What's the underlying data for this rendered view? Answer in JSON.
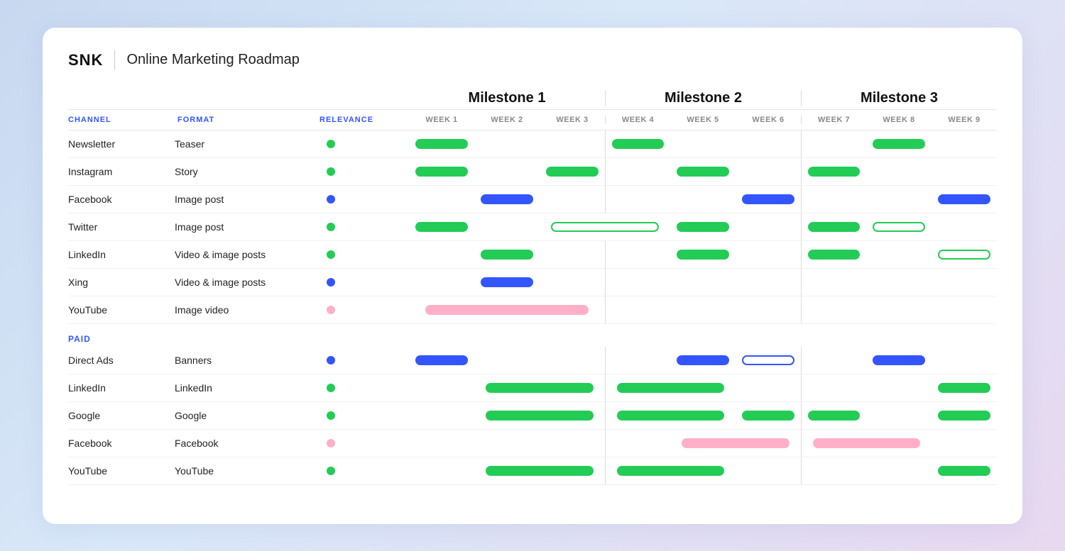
{
  "header": {
    "logo": "SNK",
    "title": "Online Marketing Roadmap"
  },
  "milestones": [
    {
      "label": "Milestone 1",
      "weeks": [
        "WEEK 1",
        "WEEK 2",
        "WEEK 3"
      ]
    },
    {
      "label": "Milestone 2",
      "weeks": [
        "WEEK 4",
        "WEEK 5",
        "WEEK 6"
      ]
    },
    {
      "label": "Milestone 3",
      "weeks": [
        "WEEK 7",
        "WEEK 8",
        "WEEK 9"
      ]
    }
  ],
  "columns": {
    "channel": "CHANNEL",
    "format": "FORMAT",
    "relevance": "RELEVANCE"
  },
  "sections": {
    "organic_label": "",
    "paid_label": "PAID"
  },
  "rows": [
    {
      "channel": "Newsletter",
      "format": "Teaser",
      "dot": "green",
      "bars": [
        {
          "w": 1,
          "type": "green",
          "w_start": 1
        },
        {
          "w": 1,
          "type": "green",
          "w_start": 4
        },
        {
          "w": 1,
          "type": "green",
          "w_start": 8
        }
      ]
    },
    {
      "channel": "Instagram",
      "format": "Story",
      "dot": "green",
      "bars": [
        {
          "w": 1,
          "type": "green",
          "w_start": 1
        },
        {
          "w": 1,
          "type": "green",
          "w_start": 3
        },
        {
          "w": 1,
          "type": "green",
          "w_start": 5
        },
        {
          "w": 1,
          "type": "green",
          "w_start": 7
        }
      ]
    },
    {
      "channel": "Facebook",
      "format": "Image post",
      "dot": "blue",
      "bars": [
        {
          "w": 1,
          "type": "blue",
          "w_start": 2
        },
        {
          "w": 1,
          "type": "blue",
          "w_start": 6
        },
        {
          "w": 1,
          "type": "blue",
          "w_start": 9
        }
      ]
    },
    {
      "channel": "Twitter",
      "format": "Image post",
      "dot": "green",
      "bars": [
        {
          "w": 1,
          "type": "green",
          "w_start": 1
        },
        {
          "w": 2,
          "type": "outline-green",
          "w_start": 3
        },
        {
          "w": 1,
          "type": "green",
          "w_start": 5
        },
        {
          "w": 1,
          "type": "green",
          "w_start": 7
        },
        {
          "w": 1,
          "type": "outline-green",
          "w_start": 8
        }
      ]
    },
    {
      "channel": "LinkedIn",
      "format": "Video & image posts",
      "dot": "green",
      "bars": [
        {
          "w": 1,
          "type": "green",
          "w_start": 2
        },
        {
          "w": 1,
          "type": "green",
          "w_start": 5
        },
        {
          "w": 1,
          "type": "green",
          "w_start": 7
        },
        {
          "w": 1,
          "type": "outline-green",
          "w_start": 9
        }
      ]
    },
    {
      "channel": "Xing",
      "format": "Video & image posts",
      "dot": "blue",
      "bars": [
        {
          "w": 1,
          "type": "blue",
          "w_start": 2
        }
      ]
    },
    {
      "channel": "YouTube",
      "format": "Image video",
      "dot": "pink",
      "bars": [
        {
          "w": 3,
          "type": "pink",
          "w_start": 1
        }
      ]
    },
    {
      "section": "PAID"
    },
    {
      "channel": "Direct Ads",
      "format": "Banners",
      "dot": "blue",
      "bars": [
        {
          "w": 1,
          "type": "blue",
          "w_start": 1
        },
        {
          "w": 1,
          "type": "blue",
          "w_start": 5
        },
        {
          "w": 1,
          "type": "outline-blue",
          "w_start": 6
        },
        {
          "w": 1,
          "type": "blue",
          "w_start": 8
        }
      ]
    },
    {
      "channel": "LinkedIn",
      "format": "LinkedIn",
      "dot": "green",
      "bars": [
        {
          "w": 2,
          "type": "green",
          "w_start": 2
        },
        {
          "w": 2,
          "type": "green",
          "w_start": 4
        },
        {
          "w": 1,
          "type": "green",
          "w_start": 9
        }
      ]
    },
    {
      "channel": "Google",
      "format": "Google",
      "dot": "green",
      "bars": [
        {
          "w": 2,
          "type": "green",
          "w_start": 2
        },
        {
          "w": 2,
          "type": "green",
          "w_start": 4
        },
        {
          "w": 1,
          "type": "green",
          "w_start": 6
        },
        {
          "w": 1,
          "type": "green",
          "w_start": 7
        },
        {
          "w": 1,
          "type": "green",
          "w_start": 9
        }
      ]
    },
    {
      "channel": "Facebook",
      "format": "Facebook",
      "dot": "pink",
      "bars": [
        {
          "w": 2,
          "type": "pink",
          "w_start": 5
        },
        {
          "w": 2,
          "type": "pink",
          "w_start": 7
        }
      ]
    },
    {
      "channel": "YouTube",
      "format": "YouTube",
      "dot": "green",
      "bars": [
        {
          "w": 2,
          "type": "green",
          "w_start": 2
        },
        {
          "w": 2,
          "type": "green",
          "w_start": 4
        },
        {
          "w": 1,
          "type": "green",
          "w_start": 9
        }
      ]
    }
  ]
}
